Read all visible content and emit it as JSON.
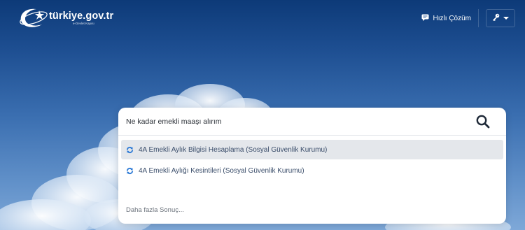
{
  "header": {
    "logo_name": "türkiye.gov.tr",
    "logo_tagline": "e-Devlet Kapısı",
    "quick_solution_label": "Hızlı Çözüm"
  },
  "search": {
    "query": "Ne kadar emekli maaşı alırım",
    "results": [
      {
        "label": "4A Emekli Aylık Bilgisi Hesaplama (Sosyal Güvenlik Kurumu)"
      },
      {
        "label": "4A Emekli Aylığı Kesintileri (Sosyal Güvenlik Kurumu)"
      }
    ],
    "more_label": "Daha fazla Sonuç..."
  },
  "colors": {
    "sky_top": "#0d3a78",
    "sky_bottom": "#7ea8d8",
    "result_icon": "#2e7bd6",
    "result_text": "#3a4d6a"
  },
  "icons": [
    "logo-crescent-icon",
    "chat-icon",
    "key-icon",
    "chevron-down-icon",
    "search-icon",
    "refresh-icon"
  ]
}
